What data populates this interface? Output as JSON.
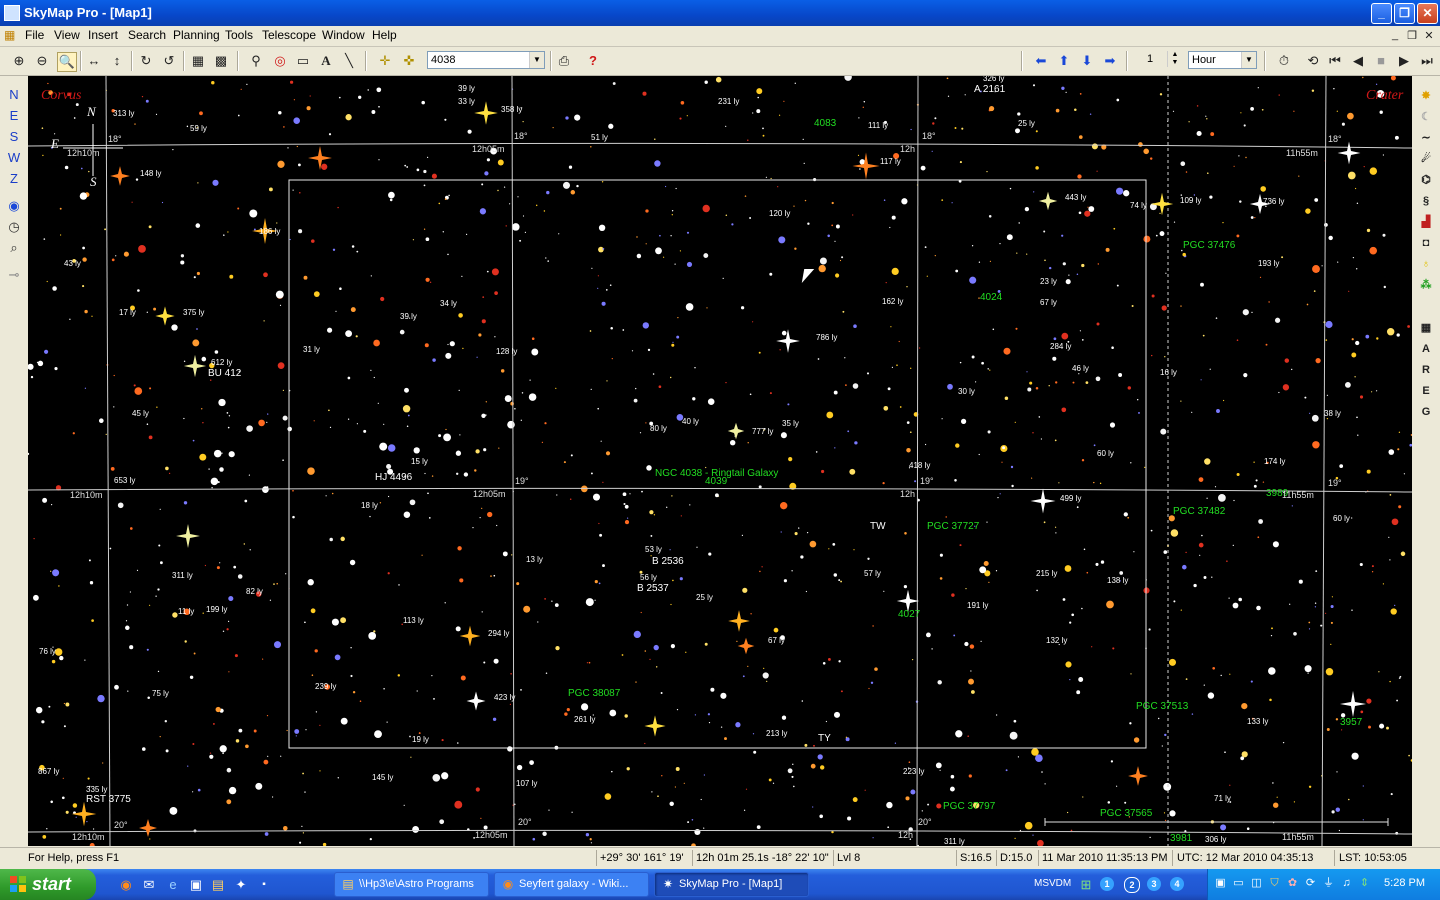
{
  "window": {
    "title": "SkyMap Pro - [Map1]",
    "minimize": "_",
    "restore": "❐",
    "close": "✕"
  },
  "menu": [
    "File",
    "View",
    "Insert",
    "Search",
    "Planning",
    "Tools",
    "Telescope",
    "Window",
    "Help"
  ],
  "mdi_controls": [
    "_",
    "❐",
    "✕"
  ],
  "toolbar": {
    "object_search_value": "4038",
    "step_value": "1",
    "time_unit_value": "Hour"
  },
  "left_tools": [
    "N",
    "E",
    "S",
    "W",
    "Z"
  ],
  "right_tools": [
    "A",
    "R",
    "E",
    "G"
  ],
  "map": {
    "constellations": {
      "left": "Corvus",
      "right": "Crater"
    },
    "compass": {
      "n": "N",
      "e": "E",
      "s": "S"
    },
    "ra_labels": [
      "12h10m",
      "12h05m",
      "12h",
      "11h55m",
      "12h10m",
      "12h05m",
      "12h",
      "11h55m",
      "12h10m",
      "12h05m",
      "12h",
      "11h55m"
    ],
    "dec_labels": [
      "18°",
      "18°",
      "18°",
      "18°",
      "19°",
      "19°",
      "19°",
      "20°",
      "20°",
      "20°"
    ],
    "named_objects": [
      {
        "text": "NGC 4038 - Ringtail Galaxy",
        "color": "#22dd22"
      },
      {
        "text": "4039",
        "color": "#22dd22"
      },
      {
        "text": "4083",
        "color": "#22dd22"
      },
      {
        "text": "4024",
        "color": "#22dd22"
      },
      {
        "text": "PGC 37476",
        "color": "#22dd22"
      },
      {
        "text": "PGC 37727",
        "color": "#22dd22"
      },
      {
        "text": "PGC 37482",
        "color": "#22dd22"
      },
      {
        "text": "3989",
        "color": "#22dd22"
      },
      {
        "text": "4027",
        "color": "#22dd22"
      },
      {
        "text": "PGC 38087",
        "color": "#22dd22"
      },
      {
        "text": "PGC 37513",
        "color": "#22dd22"
      },
      {
        "text": "3957",
        "color": "#22dd22"
      },
      {
        "text": "PGC 37797",
        "color": "#22dd22"
      },
      {
        "text": "PGC 37565",
        "color": "#22dd22"
      },
      {
        "text": "3981",
        "color": "#22dd22"
      },
      {
        "text": "A 2161",
        "color": "#ffffff"
      },
      {
        "text": "BU 412",
        "color": "#ffffff"
      },
      {
        "text": "HJ 4496",
        "color": "#ffffff"
      },
      {
        "text": "B 2536",
        "color": "#ffffff"
      },
      {
        "text": "B 2537",
        "color": "#ffffff"
      },
      {
        "text": "RST 3775",
        "color": "#ffffff"
      },
      {
        "text": "TW",
        "color": "#ffffff"
      },
      {
        "text": "TY",
        "color": "#ffffff"
      }
    ],
    "distance_labels": [
      "313 ly",
      "59 ly",
      "39 ly",
      "33 ly",
      "358 ly",
      "231 ly",
      "51 ly",
      "111 ly",
      "326 ly",
      "25 ly",
      "117 ly",
      "148 ly",
      "120 ly",
      "109 ly",
      "443 ly",
      "74 ly",
      "736 ly",
      "186 ly",
      "23 ly",
      "193 ly",
      "43 ly",
      "67 ly",
      "39 ly",
      "34 ly",
      "162 ly",
      "17 ly",
      "375 ly",
      "786 ly",
      "284 ly",
      "46 ly",
      "31 ly",
      "128 ly",
      "16 ly",
      "612 ly",
      "30 ly",
      "45 ly",
      "38 ly",
      "80 ly",
      "40 ly",
      "35 ly",
      "777 ly",
      "60 ly",
      "174 ly",
      "15 ly",
      "418 ly",
      "653 ly",
      "18 ly",
      "499 ly",
      "60 ly",
      "53 ly",
      "13 ly",
      "56 ly",
      "57 ly",
      "215 ly",
      "138 ly",
      "311 ly",
      "82 ly",
      "25 ly",
      "11 ly",
      "199 ly",
      "67 ly",
      "191 ly",
      "113 ly",
      "294 ly",
      "132 ly",
      "76 ly",
      "239 ly",
      "75 ly",
      "423 ly",
      "261 ly",
      "133 ly",
      "19 ly",
      "213 ly",
      "867 ly",
      "145 ly",
      "107 ly",
      "223 ly",
      "335 ly",
      "71 ly",
      "311 ly",
      "306 ly"
    ]
  },
  "status": {
    "help": "For Help, press F1",
    "altaz": "+29° 30'  161° 19'",
    "radec": "12h 01m 25.1s  -18° 22' 10\"",
    "level": "Lvl 8",
    "scale": "S:16.5",
    "depth": "D:15.0",
    "local_time": "11 Mar 2010 11:35:13 PM",
    "utc": "UTC: 12 Mar 2010 04:35:13",
    "lst": "LST: 10:53:05"
  },
  "taskbar": {
    "start": "start",
    "tasks": [
      {
        "label": "\\\\Hp3\\e\\Astro Programs",
        "active": false
      },
      {
        "label": "Seyfert galaxy - Wiki...",
        "active": false
      },
      {
        "label": "SkyMap Pro - [Map1]",
        "active": true
      }
    ],
    "desktops_label": "MSVDM",
    "desktops": [
      "1",
      "2",
      "3",
      "4"
    ],
    "clock": "5:28 PM"
  },
  "colors": {
    "map_bg": "#000000",
    "grid": "#cfcfcf",
    "object_label": "#22dd22",
    "constellation": "#d01818"
  }
}
